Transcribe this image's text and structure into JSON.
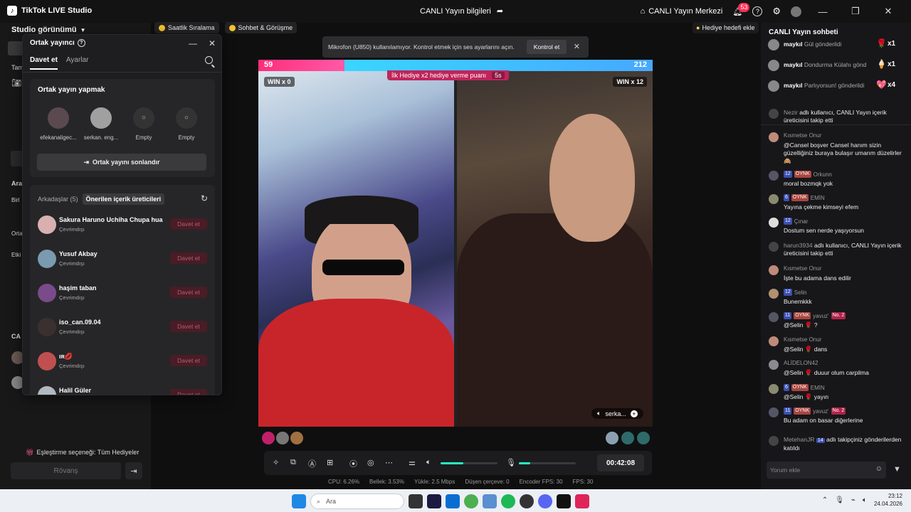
{
  "titlebar": {
    "app_title": "TikTok LIVE Studio",
    "center_title": "CANLI Yayın bilgileri",
    "live_center": "CANLI Yayın Merkezi",
    "notif_count": "53"
  },
  "left": {
    "studio_view": "Studio görünümü",
    "chips": [
      "Saatlik Sıralama",
      "Sohbet & Görüşme"
    ],
    "frag1": "Tam",
    "frag2": "Ara",
    "frag3": "Birl",
    "frag4": "Orta",
    "frag5": "Etki",
    "frag6": "CA",
    "match_option": "Eşleştirme seçeneği: Tüm Hediyeler",
    "rematch": "Rövanş"
  },
  "popup": {
    "title": "Ortak yayıncı",
    "tabs": [
      "Davet et",
      "Ayarlar"
    ],
    "section_title": "Ortak yayın yapmak",
    "hosts": [
      "efekanaligec...",
      "serkan. eng...",
      "Empty",
      "Empty"
    ],
    "end_button": "Ortak yayını sonlandır",
    "subtabs": [
      "Arkadaşlar (5)",
      "Önerilen içerik üreticileri"
    ],
    "friends": [
      {
        "name": "Sakura Haruno Uchiha Chupa hua",
        "status": "Çevrimdışı",
        "action": "Davet et"
      },
      {
        "name": "Yusuf Akbay",
        "status": "Çevrimdışı",
        "action": "Davet et"
      },
      {
        "name": "haşim taban",
        "status": "Çevrimdışı",
        "action": "Davet et"
      },
      {
        "name": "iso_can.09.04",
        "status": "Çevrimdışı",
        "action": "Davet et"
      },
      {
        "name": "ıʀ💋",
        "status": "Çevrimdışı",
        "action": "Davet et"
      },
      {
        "name": "Halil Güler",
        "status": "",
        "action": "Davet et"
      }
    ]
  },
  "toast": {
    "text": "Mikrofon (U850) kullanılamıyor. Kontrol etmek için ses ayarlarını açın.",
    "button": "Kontrol et"
  },
  "goal_button": "Hediye hedefi ekle",
  "battle": {
    "score_left": "59",
    "score_right": "212",
    "left_share": 0.218,
    "bonus_text": "İlk Hediye x2 hediye verme puanı",
    "bonus_timer": "5s",
    "win_left": "WIN x 0",
    "win_right": "WIN x 12",
    "right_name": "serka..."
  },
  "controls": {
    "timer": "00:42:08",
    "volume_level": 0.4,
    "mic_level": 0.2
  },
  "stats": {
    "cpu": "CPU:  6.26%",
    "memory": "Bellek:  3.53%",
    "upload": "Yükle:  2.5 Mbps",
    "dropped": "Düşen çerçeve:  0",
    "encoder_fps": "Encoder FPS:  30",
    "fps": "FPS:  30"
  },
  "chat": {
    "title": "CANLI Yayın sohbeti",
    "gifts": [
      {
        "user": "maykıl",
        "text": "Gül gönderildi",
        "count": "x1",
        "icon": "🌹"
      },
      {
        "user": "maykıl",
        "text": "Dondurma Külahı gönd",
        "count": "x1",
        "icon": "🍦"
      },
      {
        "user": "maykıl",
        "text": "Parlıyorsun! gönderildi",
        "count": "x4",
        "icon": "💖"
      }
    ],
    "messages": [
      {
        "type": "system",
        "user": "Nezir",
        "text": "adlı kullanıcı, CANLI Yayın içerik üreticisini takip etti"
      },
      {
        "type": "msg",
        "user": "Kısmetse Onur",
        "badges": [],
        "text": "@Cansel boşver Cansel hanım sizin güzelliğiniz buraya bulaşır umarım düzelirler 🙈"
      },
      {
        "type": "msg",
        "user": "Orkunn",
        "badges": [
          "12",
          "OYNK"
        ],
        "text": "moral bozmqk yok"
      },
      {
        "type": "msg",
        "user": "EMİN",
        "badges": [
          "6",
          "OYNK"
        ],
        "text": "Yayına çekme kimseyi efem"
      },
      {
        "type": "msg",
        "user": "Çınar",
        "badges": [
          "12"
        ],
        "text": "Dostum sen nerde yaşıyorsun"
      },
      {
        "type": "system",
        "user": "harun3934",
        "text": "adlı kullanıcı, CANLI Yayın içerik üreticisini takip etti"
      },
      {
        "type": "msg",
        "user": "Kısmetse Onur",
        "badges": [],
        "text": "İşte bu adama dans edilir"
      },
      {
        "type": "msg",
        "user": "Selin",
        "badges": [
          "12"
        ],
        "text": "Bunemkkk"
      },
      {
        "type": "msg",
        "user": "yavuz'",
        "badges": [
          "11",
          "OYNK",
          "No. 2"
        ],
        "text": "@Selin 🌹 ?"
      },
      {
        "type": "msg",
        "user": "Kısmetse Onur",
        "badges": [],
        "text": "@Selin 🌹 dans"
      },
      {
        "type": "msg",
        "user": "ALİDELON42",
        "badges": [],
        "text": "@Selin 🌹 duuur olum carpilma"
      },
      {
        "type": "msg",
        "user": "EMİN",
        "badges": [
          "6",
          "OYNK"
        ],
        "text": "@Selin 🌹 yayın"
      },
      {
        "type": "msg",
        "user": "yavuz'",
        "badges": [
          "11",
          "OYNK",
          "No. 2"
        ],
        "text": "Bu adam on basar diğerlerine"
      },
      {
        "type": "system",
        "user": "MetehanJR",
        "badges": [
          "14"
        ],
        "text": "adlı takipçiniz gönderilerden katıldı"
      }
    ],
    "input_placeholder": "Yorum ekle"
  },
  "taskbar": {
    "search": "Ara",
    "time": "23:12",
    "date": "24.04.2026"
  }
}
